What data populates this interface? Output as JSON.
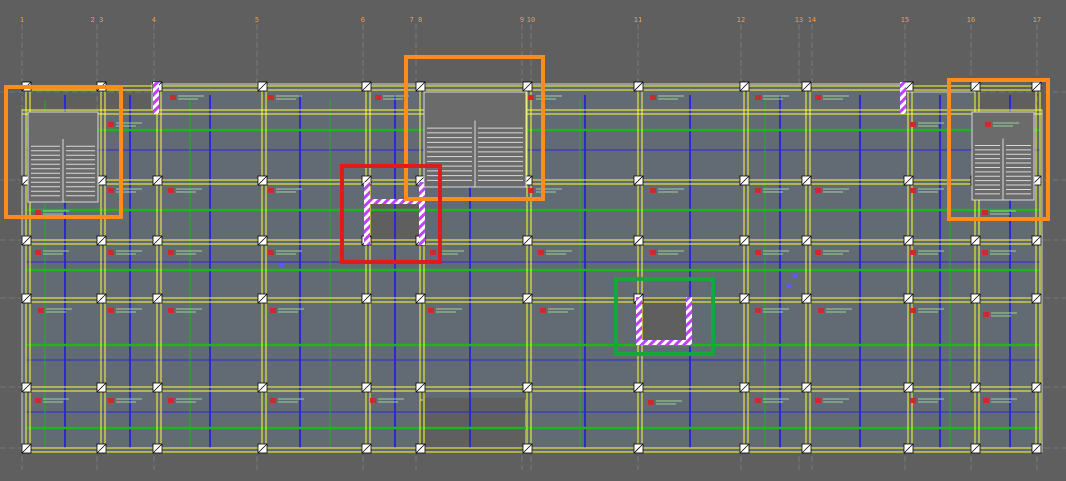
{
  "viewport": {
    "background": "#5f5f5f"
  },
  "axes": {
    "labels": [
      "1",
      "2",
      "3",
      "4",
      "5",
      "6",
      "7",
      "8",
      "9",
      "10",
      "11",
      "12",
      "13",
      "14",
      "15",
      "16",
      "17"
    ],
    "label_color": "#ff9a3c",
    "line_color": "#8a8a8a"
  },
  "colors": {
    "slab": "#626a73",
    "beam_yellow": "#ffff33",
    "rebar_green": "#1fb31f",
    "rebar_blue": "#2a2ad0",
    "column_fill": "#ffffff",
    "hatch_purple": "#c040ff",
    "tag_red": "#cc2b2b",
    "stair": "#d8d8d8"
  },
  "highlights": [
    {
      "name": "stair-highlight-left",
      "color": "#ff8c1a"
    },
    {
      "name": "stair-highlight-center",
      "color": "#ff8c1a"
    },
    {
      "name": "stair-highlight-right",
      "color": "#ff8c1a"
    },
    {
      "name": "opening-highlight-red",
      "color": "#e01b1b"
    },
    {
      "name": "opening-highlight-green",
      "color": "#12a83c"
    }
  ]
}
